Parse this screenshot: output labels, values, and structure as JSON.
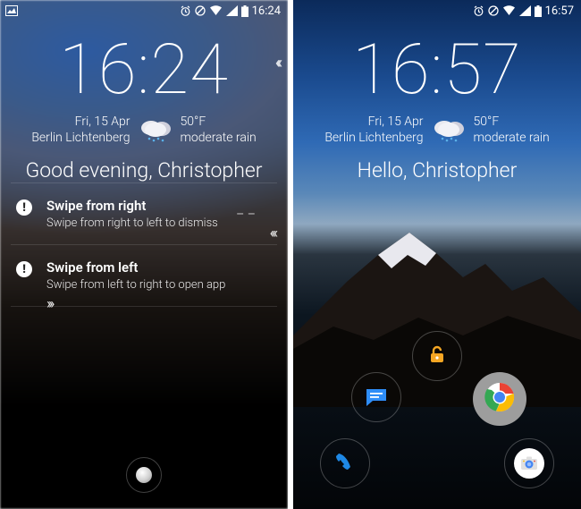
{
  "left": {
    "status": {
      "time": "16:24"
    },
    "clock": "16:24",
    "date": "Fri, 15 Apr",
    "location": "Berlin Lichtenberg",
    "temp": "50°F",
    "condition": "moderate rain",
    "greeting": "Good evening, Christopher",
    "notifications": [
      {
        "title": "Swipe from right",
        "subtitle": "Swipe from right to left to dismiss"
      },
      {
        "title": "Swipe from left",
        "subtitle": "Swipe from left to right to open app"
      }
    ]
  },
  "right": {
    "status": {
      "time": "16:57"
    },
    "clock": "16:57",
    "date": "Fri, 15 Apr",
    "location": "Berlin Lichtenberg",
    "temp": "50°F",
    "condition": "moderate rain",
    "greeting": "Hello, Christopher",
    "shortcuts": {
      "top": "unlock",
      "left": "messages",
      "right": "chrome",
      "bottom_left": "phone",
      "bottom_right": "camera"
    }
  }
}
